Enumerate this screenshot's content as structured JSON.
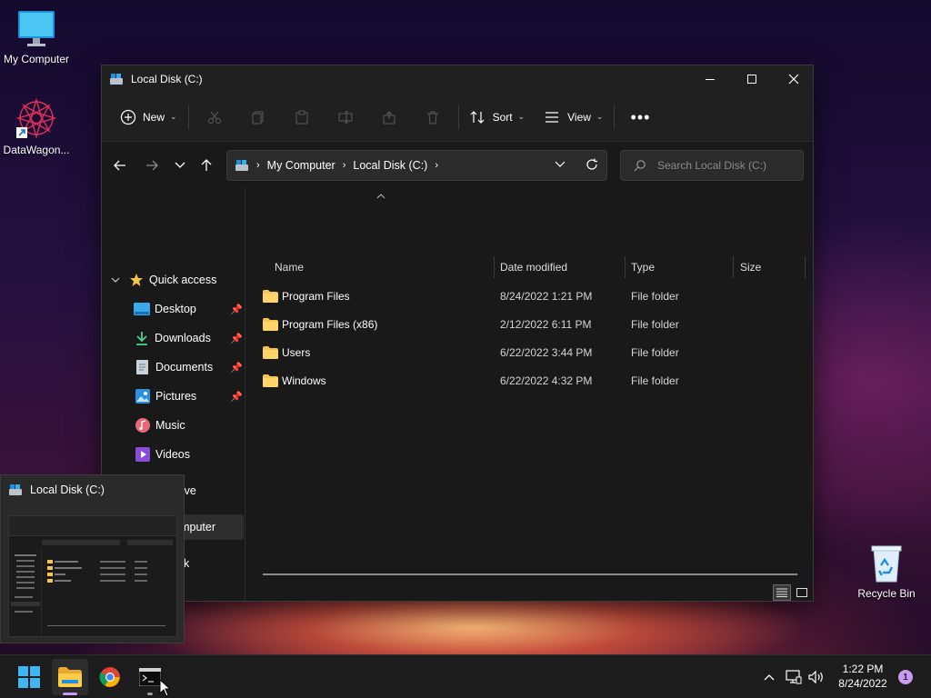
{
  "desktop": {
    "icons": [
      {
        "label": "My Computer"
      },
      {
        "label": "DataWagon..."
      },
      {
        "label": "Recycle Bin"
      }
    ]
  },
  "window": {
    "title": "Local Disk (C:)",
    "toolbar": {
      "new_label": "New",
      "sort_label": "Sort",
      "view_label": "View"
    },
    "address": {
      "crumbs": [
        "My Computer",
        "Local Disk (C:)"
      ]
    },
    "search": {
      "placeholder": "Search Local Disk (C:)"
    },
    "sidebar": {
      "quick_access": "Quick access",
      "items": [
        {
          "label": "Desktop",
          "icon": "desktop-icon",
          "pinned": true
        },
        {
          "label": "Downloads",
          "icon": "download-icon",
          "pinned": true
        },
        {
          "label": "Documents",
          "icon": "document-icon",
          "pinned": true
        },
        {
          "label": "Pictures",
          "icon": "picture-icon",
          "pinned": true
        },
        {
          "label": "Music",
          "icon": "music-icon",
          "pinned": false
        },
        {
          "label": "Videos",
          "icon": "video-icon",
          "pinned": false
        }
      ],
      "onedrive": "OneDrive",
      "my_computer": "My Computer",
      "network_partial": "k"
    },
    "columns": [
      "Name",
      "Date modified",
      "Type",
      "Size"
    ],
    "files": [
      {
        "name": "Program Files",
        "date": "8/24/2022 1:21 PM",
        "type": "File folder",
        "size": ""
      },
      {
        "name": "Program Files (x86)",
        "date": "2/12/2022 6:11 PM",
        "type": "File folder",
        "size": ""
      },
      {
        "name": "Users",
        "date": "6/22/2022 3:44 PM",
        "type": "File folder",
        "size": ""
      },
      {
        "name": "Windows",
        "date": "6/22/2022 4:32 PM",
        "type": "File folder",
        "size": ""
      }
    ]
  },
  "thumbnail": {
    "title": "Local Disk (C:)"
  },
  "taskbar": {
    "time": "1:22 PM",
    "date": "8/24/2022",
    "notification_count": "1"
  },
  "colors": {
    "folder": "#f4c552",
    "accent": "#60cdff",
    "badge": "#c89af0"
  }
}
